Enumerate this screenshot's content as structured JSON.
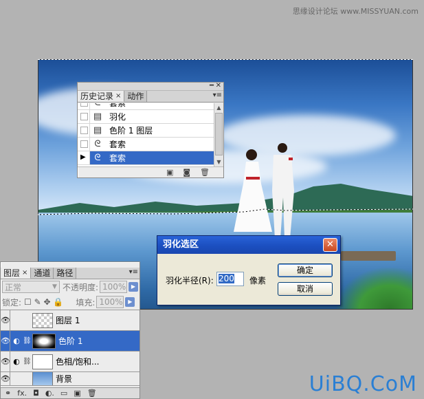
{
  "watermark": "思缘设计论坛 www.MISSYUAN.com",
  "brand": "UiBQ.CoM",
  "history": {
    "tabs": [
      {
        "label": "历史记录",
        "close": "×",
        "active": true
      },
      {
        "label": "动作",
        "active": false
      }
    ],
    "menu_icon": "▾≡",
    "items": [
      {
        "label": "套索",
        "icon": "lasso-icon",
        "glyph": "ᘓ",
        "selected": false
      },
      {
        "label": "羽化",
        "icon": "document-icon",
        "glyph": "▤",
        "selected": false
      },
      {
        "label": "色阶 1 图层",
        "icon": "document-icon",
        "glyph": "▤",
        "selected": false
      },
      {
        "label": "套索",
        "icon": "lasso-icon",
        "glyph": "ᘓ",
        "selected": false
      },
      {
        "label": "套索",
        "icon": "lasso-icon",
        "glyph": "ᘓ",
        "selected": true
      }
    ],
    "history_brush": "▶",
    "footer_icons": [
      "snapshot-document-icon",
      "camera-icon",
      "trash-icon"
    ],
    "footer_glyphs": [
      "▣",
      "◙",
      "🗑"
    ]
  },
  "dialog": {
    "title": "羽化选区",
    "close": "✕",
    "field_label": "羽化半径(R):",
    "field_value": "200",
    "unit": "像素",
    "ok_label": "确定",
    "cancel_label": "取消"
  },
  "layers": {
    "tabs": [
      {
        "label": "图层",
        "close": "×",
        "active": true
      },
      {
        "label": "通道",
        "active": false
      },
      {
        "label": "路径",
        "active": false
      }
    ],
    "menu_icon": "▾≡",
    "blend_mode": "正常",
    "opacity_label": "不透明度:",
    "opacity_value": "100%",
    "lock_label": "锁定:",
    "lock_icons": "☐ ✎ ✥ 🔒",
    "fill_label": "填充:",
    "fill_value": "100%",
    "arrow": "▶",
    "eye": "👁",
    "items": [
      {
        "name": "图层 1",
        "thumb": "transparent",
        "selected": false
      },
      {
        "name": "色阶 1",
        "thumb": "mask",
        "selected": true
      },
      {
        "name": "色相/饱和...",
        "thumb": "white",
        "selected": false
      },
      {
        "name": "背景",
        "thumb": "photo",
        "selected": false
      }
    ],
    "footer_glyphs": [
      "⚭",
      "fx.",
      "◘",
      "◐.",
      "▭",
      "▣",
      "🗑"
    ]
  }
}
